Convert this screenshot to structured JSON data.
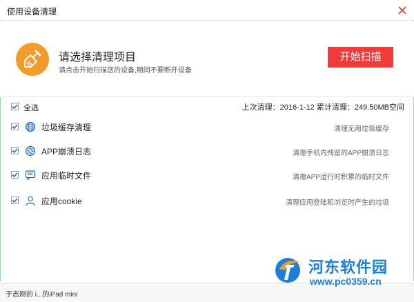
{
  "window": {
    "title": "使用设备清理"
  },
  "header": {
    "title": "请选择清理项目",
    "subtitle": "请点击开始扫描您的设备,期间不要断开设备",
    "scan_button": "开始扫描"
  },
  "select_all": {
    "label": "全选",
    "checked": true,
    "stats": "上次清理：2016-1-12 累计清理：249.50MB空间"
  },
  "items": [
    {
      "label": "垃圾缓存清理",
      "desc": "清理无用垃圾缓存",
      "icon": "globe-icon",
      "checked": true
    },
    {
      "label": "APP崩溃日志",
      "desc": "清理手机内残留的APP崩溃日志",
      "icon": "aperture-icon",
      "checked": true
    },
    {
      "label": "应用临时文件",
      "desc": "清理APP运行时积累的临时文件",
      "icon": "message-icon",
      "checked": true
    },
    {
      "label": "应用cookie",
      "desc": "清理应用登陆和浏览时产生的垃圾",
      "icon": "user-icon",
      "checked": true
    }
  ],
  "status": {
    "device": "于志刚的 i...的iPad mini"
  },
  "watermark": {
    "name": "河东软件园",
    "url": "www.pc0359.cn"
  },
  "colors": {
    "accent": "#f03b3b",
    "broom": "#f39c2b",
    "icon_blue": "#1e6fbf",
    "frame_green": "#9fd6a0"
  }
}
